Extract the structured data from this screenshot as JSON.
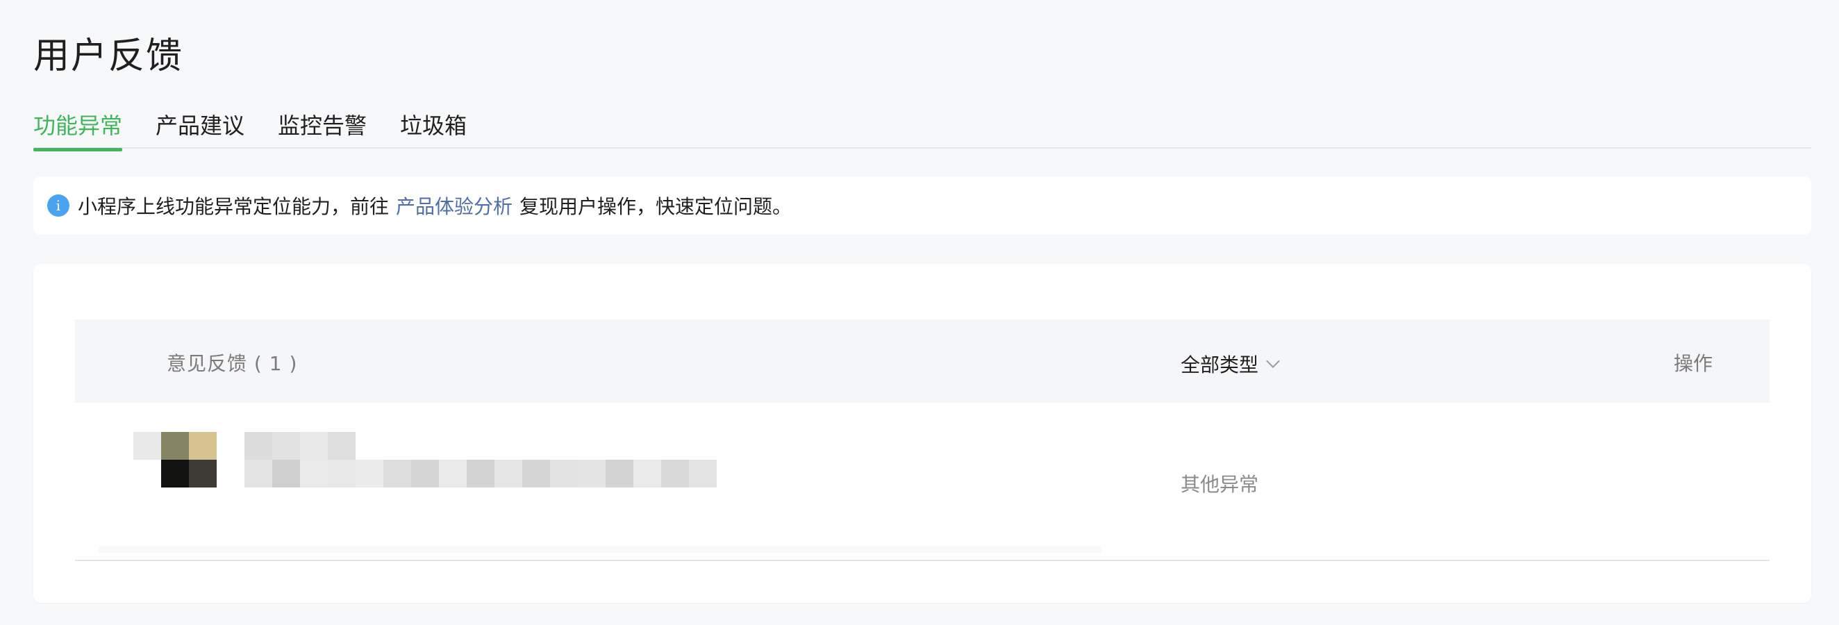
{
  "page": {
    "title": "用户反馈"
  },
  "tabs": [
    {
      "label": "功能异常",
      "active": true
    },
    {
      "label": "产品建议",
      "active": false
    },
    {
      "label": "监控告警",
      "active": false
    },
    {
      "label": "垃圾箱",
      "active": false
    }
  ],
  "notice": {
    "icon": "info-icon",
    "icon_glyph": "i",
    "text_before": "小程序上线功能异常定位能力，前往",
    "link_text": "产品体验分析",
    "text_after": "复现用户操作，快速定位问题。"
  },
  "table": {
    "columns": {
      "feedback": "意见反馈 ( 1 )",
      "type_filter": "全部类型",
      "action": "操作"
    },
    "rows": [
      {
        "avatar": "pixelated-avatar",
        "content": "pixelated-feedback-text",
        "type": "其他异常",
        "action": ""
      }
    ]
  },
  "colors": {
    "accent": "#3fb55c",
    "link": "#4f6ea8",
    "info": "#4aa3f0",
    "background": "#f7f8fa"
  }
}
